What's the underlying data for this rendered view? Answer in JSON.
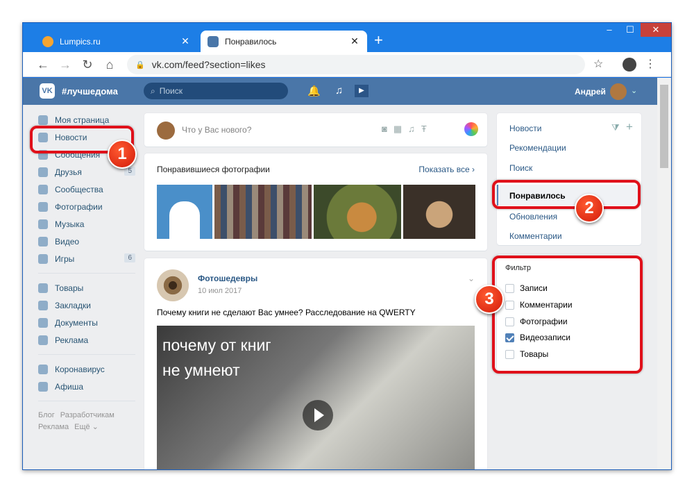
{
  "browser": {
    "tabs": [
      {
        "label": "Lumpics.ru",
        "close": "✕"
      },
      {
        "label": "Понравилось",
        "close": "✕"
      }
    ],
    "new_tab": "+",
    "window_controls": {
      "minimize": "–",
      "maximize": "☐",
      "close": "✕"
    },
    "nav": {
      "back": "←",
      "forward": "→",
      "reload": "↻",
      "home": "⌂"
    },
    "url": "vk.com/feed?section=likes",
    "bookmark": "☆",
    "menu": "⋮"
  },
  "vk_header": {
    "logo": "VK",
    "hashtag": "#лучшедома",
    "search_placeholder": "Поиск",
    "user_name": "Андрей",
    "caret": "⌄"
  },
  "left_menu": {
    "items": [
      {
        "label": "Моя страница"
      },
      {
        "label": "Новости"
      },
      {
        "label": "Сообщения"
      },
      {
        "label": "Друзья",
        "count": "5"
      },
      {
        "label": "Сообщества"
      },
      {
        "label": "Фотографии"
      },
      {
        "label": "Музыка"
      },
      {
        "label": "Видео"
      },
      {
        "label": "Игры",
        "count": "6"
      }
    ],
    "items2": [
      {
        "label": "Товары"
      },
      {
        "label": "Закладки"
      },
      {
        "label": "Документы"
      },
      {
        "label": "Реклама"
      }
    ],
    "items3": [
      {
        "label": "Коронавирус"
      },
      {
        "label": "Афиша"
      }
    ],
    "footer": [
      "Блог",
      "Разработчикам",
      "Реклама",
      "Ещё ⌄"
    ]
  },
  "compose": {
    "placeholder": "Что у Вас нового?"
  },
  "liked_photos": {
    "title": "Понравившиеся фотографии",
    "show_all": "Показать все ›"
  },
  "post": {
    "author": "Фотошедевры",
    "date": "10 июл 2017",
    "caret": "⌄",
    "text": "Почему книги не сделают Вас умнее? Расследование на QWERTY",
    "image_line1": "почему от книг",
    "image_line2": "не умнеют"
  },
  "right_menu": {
    "items": [
      "Новости",
      "Рекомендации",
      "Поиск",
      "Понравилось",
      "Обновления",
      "Комментарии"
    ],
    "filter_icon": "⧩",
    "add_icon": "+"
  },
  "filter": {
    "title": "Фильтр",
    "options": [
      {
        "label": "Записи",
        "checked": false
      },
      {
        "label": "Комментарии",
        "checked": false
      },
      {
        "label": "Фотографии",
        "checked": false
      },
      {
        "label": "Видеозаписи",
        "checked": true
      },
      {
        "label": "Товары",
        "checked": false
      }
    ]
  },
  "annotations": {
    "step1": "1",
    "step2": "2",
    "step3": "3"
  },
  "colors": {
    "vk_blue": "#4a76a8",
    "highlight": "#e0101a",
    "browser_blue": "#1d7ee6"
  }
}
